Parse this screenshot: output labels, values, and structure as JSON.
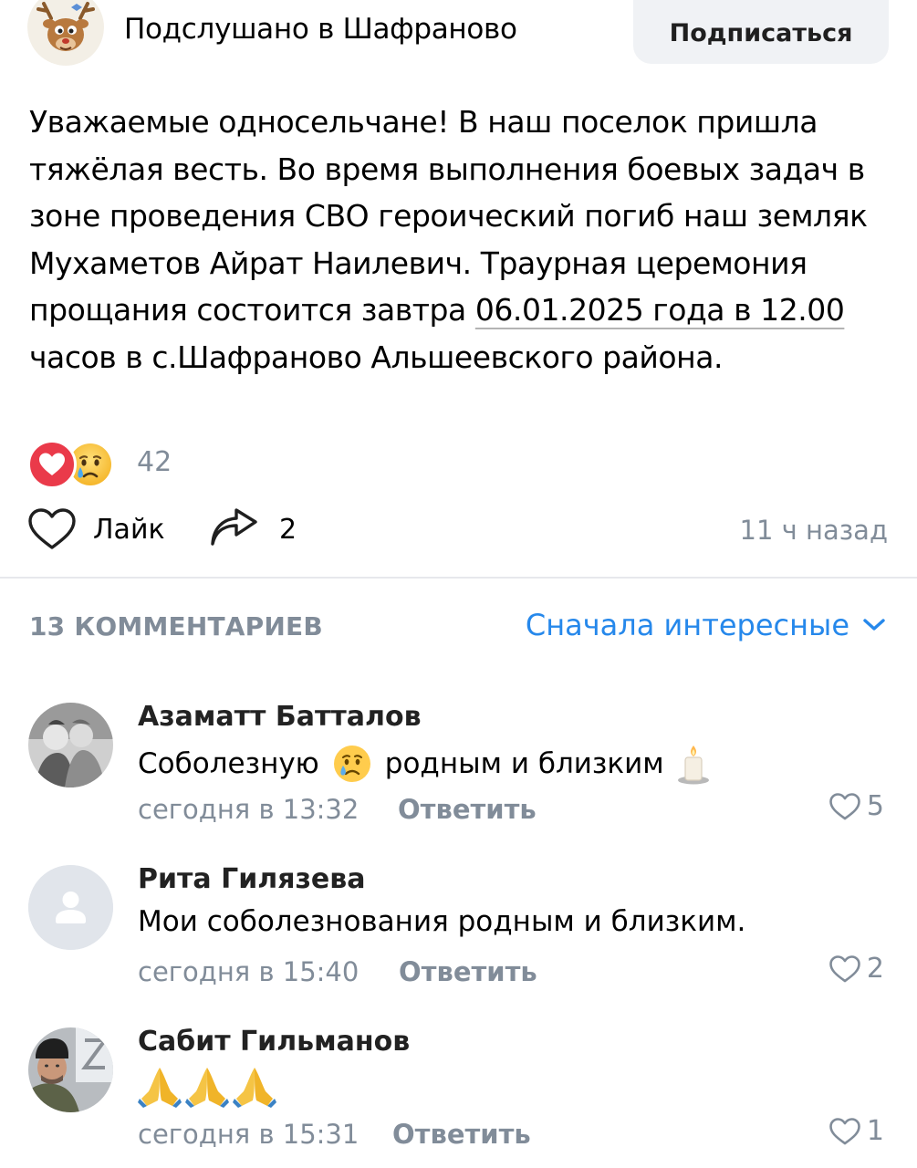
{
  "group": {
    "name": "Подслушано в Шафраново",
    "subscribe_label": "Подписаться"
  },
  "post": {
    "text_before_date": "Уважаемые односельчане! В наш поселок пришла тяжёлая весть. Во время выполнения боевых задач в зоне проведения СВО героический погиб наш земляк Мухаметов Айрат Наилевич. Траурная церемония прощания состоится завтра ",
    "date_link": "06.01.2025 года в 12.00",
    "text_after_date": " часов в с.Шафраново Альшеевского района.",
    "reactions_count": "42",
    "like_label": "Лайк",
    "share_count": "2",
    "time": "11 ч назад"
  },
  "comments_section": {
    "count_label": "13 КОММЕНТАРИЕВ",
    "sort_label": "Сначала интересные"
  },
  "comments": [
    {
      "author": "Азаматт Батталов",
      "text_part1": "Соболезную",
      "text_part2": "родным и близким",
      "time": "сегодня в 13:32",
      "reply_label": "Ответить",
      "likes": "5"
    },
    {
      "author": "Рита Гилязева",
      "text": "Мои соболезнования родным и близким.",
      "time": "сегодня в 15:40",
      "reply_label": "Ответить",
      "likes": "2"
    },
    {
      "author": "Сабит Гильманов",
      "text": "",
      "time": "сегодня в 15:31",
      "reply_label": "Ответить",
      "likes": "1"
    }
  ],
  "colors": {
    "accent": "#2688eb",
    "secondary_text": "#818c99",
    "heart_reaction": "#ea3a4a",
    "button_bg": "#f0f2f5"
  },
  "icons": {
    "group_avatar": "cartoon-deer-icon",
    "like": "heart-outline-icon",
    "share": "share-arrow-icon",
    "sort": "chevron-down-icon",
    "comment_like": "heart-outline-icon"
  }
}
